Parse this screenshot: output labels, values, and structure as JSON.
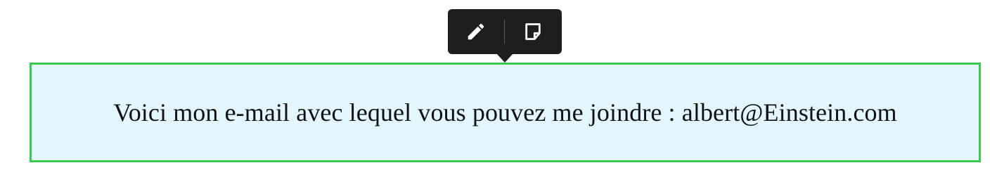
{
  "toolbar": {
    "tools": [
      {
        "icon": "pencil-icon",
        "action": "edit"
      },
      {
        "icon": "note-icon",
        "action": "note"
      }
    ],
    "background": "#1e1e20"
  },
  "callout": {
    "text": "Voici mon e-mail avec lequel vous pouvez me joindre : albert@Einstein.com",
    "border_color": "#3cc94f",
    "background": "#e4f6fd"
  }
}
